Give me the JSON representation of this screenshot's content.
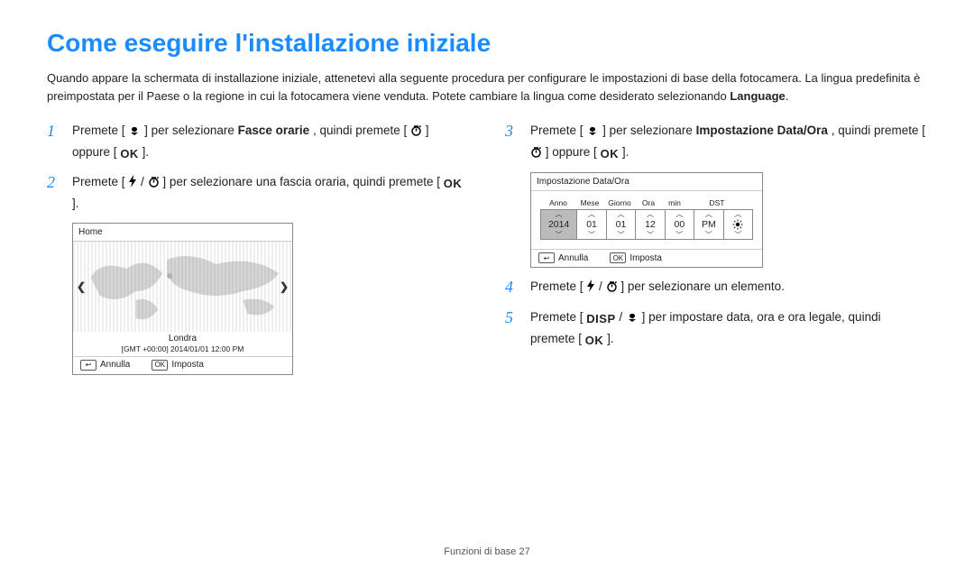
{
  "title": "Come eseguire l'installazione iniziale",
  "intro_part1": "Quando appare la schermata di installazione iniziale, attenetevi alla seguente procedura per configurare le impostazioni di base della fotocamera. La lingua predefinita è preimpostata per il Paese o la regione in cui la fotocamera viene venduta. Potete cambiare la lingua come desiderato selezionando ",
  "intro_bold": "Language",
  "intro_end": ".",
  "steps": {
    "s1_a": "Premete [",
    "s1_b": "] per selezionare ",
    "s1_bold": "Fasce orarie",
    "s1_c": ", quindi premete [",
    "s1_d": "] oppure [",
    "s1_e": "].",
    "s2_a": "Premete [",
    "s2_b": "] per selezionare una fascia oraria, quindi premete [",
    "s2_c": "].",
    "s3_a": "Premete [",
    "s3_b": "] per selezionare ",
    "s3_bold": "Impostazione Data/Ora",
    "s3_c": ", quindi premete [",
    "s3_d": "] oppure [",
    "s3_e": "].",
    "s4_a": "Premete [",
    "s4_b": "] per selezionare un elemento.",
    "s5_a": "Premete [",
    "s5_b": "] per impostare data, ora e ora legale, quindi premete [",
    "s5_c": "]."
  },
  "screen1": {
    "title": "Home",
    "city": "Londra",
    "gmt": "[GMT +00:00] 2014/01/01 12:00 PM",
    "cancel": "Annulla",
    "set": "Imposta"
  },
  "screen2": {
    "title": "Impostazione Data/Ora",
    "labels": {
      "anno": "Anno",
      "mese": "Mese",
      "giorno": "Giorno",
      "ora": "Ora",
      "min": "min",
      "dst": "DST"
    },
    "values": {
      "anno": "2014",
      "mese": "01",
      "giorno": "01",
      "ora": "12",
      "min": "00",
      "ampm": "PM"
    },
    "cancel": "Annulla",
    "set": "Imposta"
  },
  "key_ok": "OK",
  "key_disp": "DISP",
  "footer": "Funzioni di base  27"
}
